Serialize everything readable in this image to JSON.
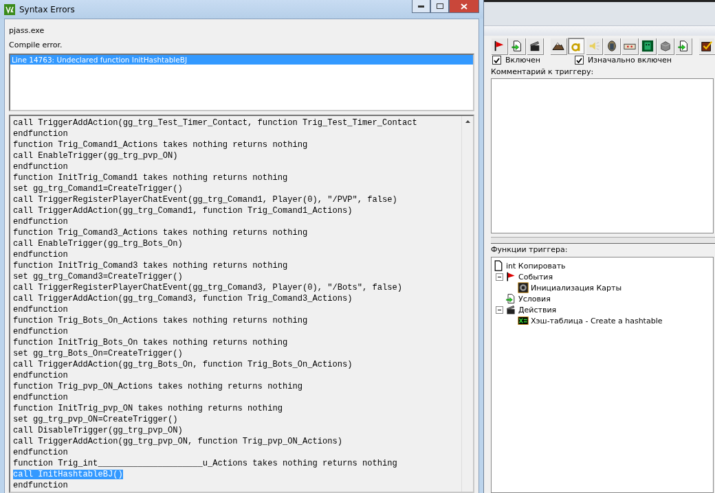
{
  "dialog": {
    "title": "Syntax Errors",
    "program": "pjass.exe",
    "message": "Compile error.",
    "errors": [
      {
        "text": "Line 14763:  Undeclared function InitHashtableBJ",
        "selected": true
      }
    ],
    "code_lines": [
      {
        "text": "call TriggerAddAction(gg_trg_Test_Timer_Contact, function Trig_Test_Timer_Contact",
        "selected": false
      },
      {
        "text": "endfunction",
        "selected": false
      },
      {
        "text": "function Trig_Comand1_Actions takes nothing returns nothing",
        "selected": false
      },
      {
        "text": "call EnableTrigger(gg_trg_pvp_ON)",
        "selected": false
      },
      {
        "text": "endfunction",
        "selected": false
      },
      {
        "text": "function InitTrig_Comand1 takes nothing returns nothing",
        "selected": false
      },
      {
        "text": "set gg_trg_Comand1=CreateTrigger()",
        "selected": false
      },
      {
        "text": "call TriggerRegisterPlayerChatEvent(gg_trg_Comand1, Player(0), \"/PVP\", false)",
        "selected": false
      },
      {
        "text": "call TriggerAddAction(gg_trg_Comand1, function Trig_Comand1_Actions)",
        "selected": false
      },
      {
        "text": "endfunction",
        "selected": false
      },
      {
        "text": "function Trig_Comand3_Actions takes nothing returns nothing",
        "selected": false
      },
      {
        "text": "call EnableTrigger(gg_trg_Bots_On)",
        "selected": false
      },
      {
        "text": "endfunction",
        "selected": false
      },
      {
        "text": "function InitTrig_Comand3 takes nothing returns nothing",
        "selected": false
      },
      {
        "text": "set gg_trg_Comand3=CreateTrigger()",
        "selected": false
      },
      {
        "text": "call TriggerRegisterPlayerChatEvent(gg_trg_Comand3, Player(0), \"/Bots\", false)",
        "selected": false
      },
      {
        "text": "call TriggerAddAction(gg_trg_Comand3, function Trig_Comand3_Actions)",
        "selected": false
      },
      {
        "text": "endfunction",
        "selected": false
      },
      {
        "text": "function Trig_Bots_On_Actions takes nothing returns nothing",
        "selected": false
      },
      {
        "text": "endfunction",
        "selected": false
      },
      {
        "text": "function InitTrig_Bots_On takes nothing returns nothing",
        "selected": false
      },
      {
        "text": "set gg_trg_Bots_On=CreateTrigger()",
        "selected": false
      },
      {
        "text": "call TriggerAddAction(gg_trg_Bots_On, function Trig_Bots_On_Actions)",
        "selected": false
      },
      {
        "text": "endfunction",
        "selected": false
      },
      {
        "text": "function Trig_pvp_ON_Actions takes nothing returns nothing",
        "selected": false
      },
      {
        "text": "endfunction",
        "selected": false
      },
      {
        "text": "function InitTrig_pvp_ON takes nothing returns nothing",
        "selected": false
      },
      {
        "text": "set gg_trg_pvp_ON=CreateTrigger()",
        "selected": false
      },
      {
        "text": "call DisableTrigger(gg_trg_pvp_ON)",
        "selected": false
      },
      {
        "text": "call TriggerAddAction(gg_trg_pvp_ON, function Trig_pvp_ON_Actions)",
        "selected": false
      },
      {
        "text": "endfunction",
        "selected": false
      },
      {
        "text": "function Trig_int_____________________u_Actions takes nothing returns nothing",
        "selected": false
      },
      {
        "text": "call InitHashtableBJ()",
        "selected": true
      },
      {
        "text": "endfunction",
        "selected": false
      }
    ]
  },
  "editor": {
    "toolbar": [
      {
        "kind": "flag",
        "selected": false
      },
      {
        "kind": "doc-arrow",
        "selected": false
      },
      {
        "kind": "clapper",
        "selected": false
      },
      {
        "kind": "mountain",
        "selected": false
      },
      {
        "kind": "letter",
        "selected": true
      },
      {
        "kind": "speaker",
        "selected": false
      },
      {
        "kind": "figure",
        "selected": false
      },
      {
        "kind": "panel",
        "selected": false
      },
      {
        "kind": "mask",
        "selected": false
      },
      {
        "kind": "cube",
        "selected": false
      },
      {
        "kind": "doc-arrow",
        "selected": false
      },
      {
        "kind": "check",
        "selected": false
      }
    ],
    "checkboxes": [
      {
        "label": "Включен",
        "checked": true
      },
      {
        "label": "Изначально включен",
        "checked": true
      }
    ],
    "comment_label": "Комментарий к триггеру:",
    "functions_label": "Функции триггера:",
    "tree": [
      {
        "label": "int Копировать",
        "kind": "doc",
        "children": [
          {
            "label": "События",
            "kind": "flag",
            "expanded": true,
            "children": [
              {
                "label": "Инициализация Карты",
                "kind": "gear"
              }
            ]
          },
          {
            "label": "Условия",
            "kind": "doc-arrow"
          },
          {
            "label": "Действия",
            "kind": "clapper",
            "expanded": true,
            "children": [
              {
                "label": "Хэш-таблица - Create a hashtable",
                "kind": "set"
              }
            ]
          }
        ]
      }
    ]
  }
}
